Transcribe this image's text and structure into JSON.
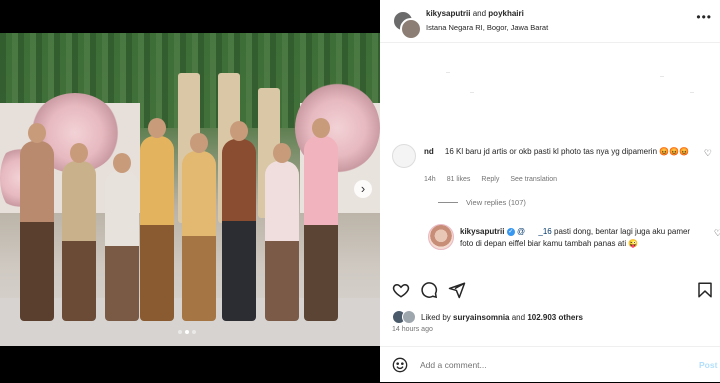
{
  "header": {
    "user1": "kikysaputrii",
    "and_text": "and",
    "user2": "poykhairi",
    "location": "Istana Negara RI, Bogor, Jawa Barat"
  },
  "comment": {
    "username": "nd",
    "text": "16 Kl baru jd artis or okb pasti kl photo tas nya yg dipamerin",
    "emojis": "😡😡😡",
    "time": "14h",
    "likes": "81 likes",
    "reply": "Reply",
    "translate": "See translation"
  },
  "view_replies": "View replies (107)",
  "reply": {
    "username": "kikysaputrii",
    "mention": "@",
    "mention_tail": "_16",
    "text": "pasti dong, bentar lagi juga aku pamer foto di depan eiffel biar kamu tambah panas ati",
    "emoji": "😜"
  },
  "likes": {
    "prefix": "Liked by",
    "user": "suryainsomnia",
    "suffix_and": "and",
    "others": "102.903 others"
  },
  "time_ago": "14 hours ago",
  "add_comment": {
    "placeholder": "Add a comment...",
    "post": "Post"
  },
  "icons": [
    "heart-icon",
    "comment-icon",
    "share-icon",
    "bookmark-icon",
    "emoji-icon",
    "more-icon",
    "next-icon"
  ],
  "carousel": {
    "total": 3,
    "active": 2
  }
}
